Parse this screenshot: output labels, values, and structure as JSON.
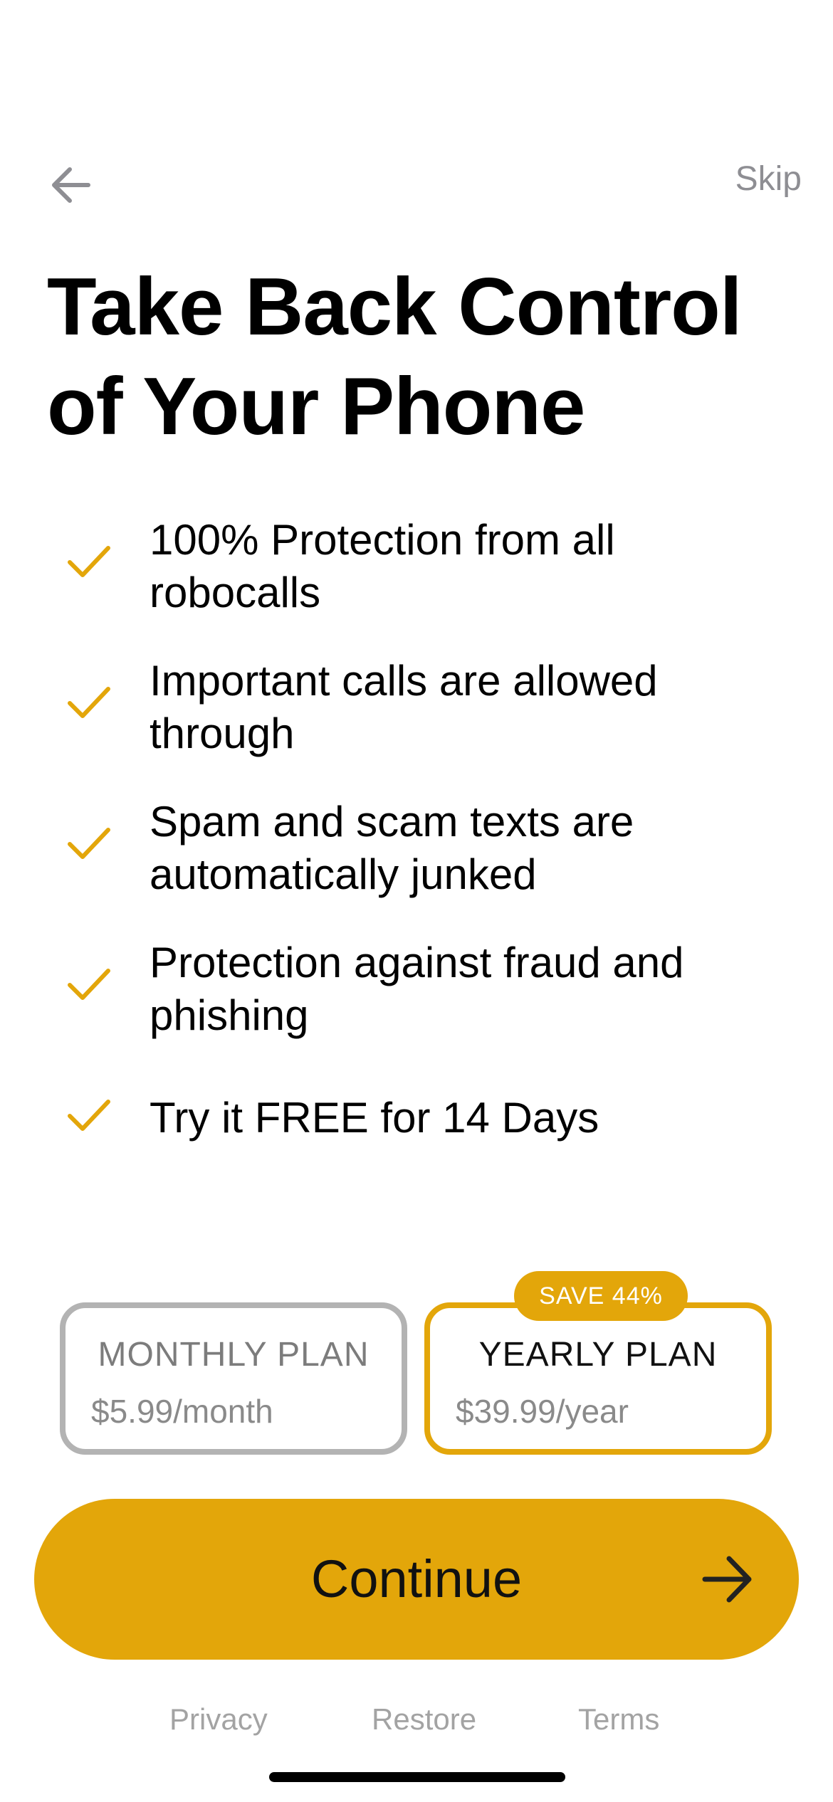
{
  "header": {
    "back_icon": "arrow-left-icon",
    "skip_label": "Skip"
  },
  "headline": "Take Back Control of Your Phone",
  "features": [
    {
      "icon": "checkmark-icon",
      "text": "100% Protection from all robocalls"
    },
    {
      "icon": "checkmark-icon",
      "text": "Important calls are allowed through"
    },
    {
      "icon": "checkmark-icon",
      "text": "Spam and scam texts are automatically junked"
    },
    {
      "icon": "checkmark-icon",
      "text": "Protection against fraud and phishing"
    },
    {
      "icon": "checkmark-icon",
      "text": "Try it FREE for 14 Days"
    }
  ],
  "plans": {
    "monthly": {
      "title": "MONTHLY PLAN",
      "price": "$5.99/month",
      "selected": false
    },
    "yearly": {
      "title": "YEARLY PLAN",
      "price": "$39.99/year",
      "selected": true,
      "badge": "SAVE 44%"
    }
  },
  "continue_button": {
    "label": "Continue",
    "icon": "arrow-right-icon"
  },
  "footer": {
    "privacy": "Privacy",
    "restore": "Restore",
    "terms": "Terms"
  },
  "colors": {
    "accent": "#e3a60a",
    "unselected_border": "#b3b3b3",
    "secondary_text": "#8e8e93",
    "footer_text": "#a3a3a3"
  }
}
